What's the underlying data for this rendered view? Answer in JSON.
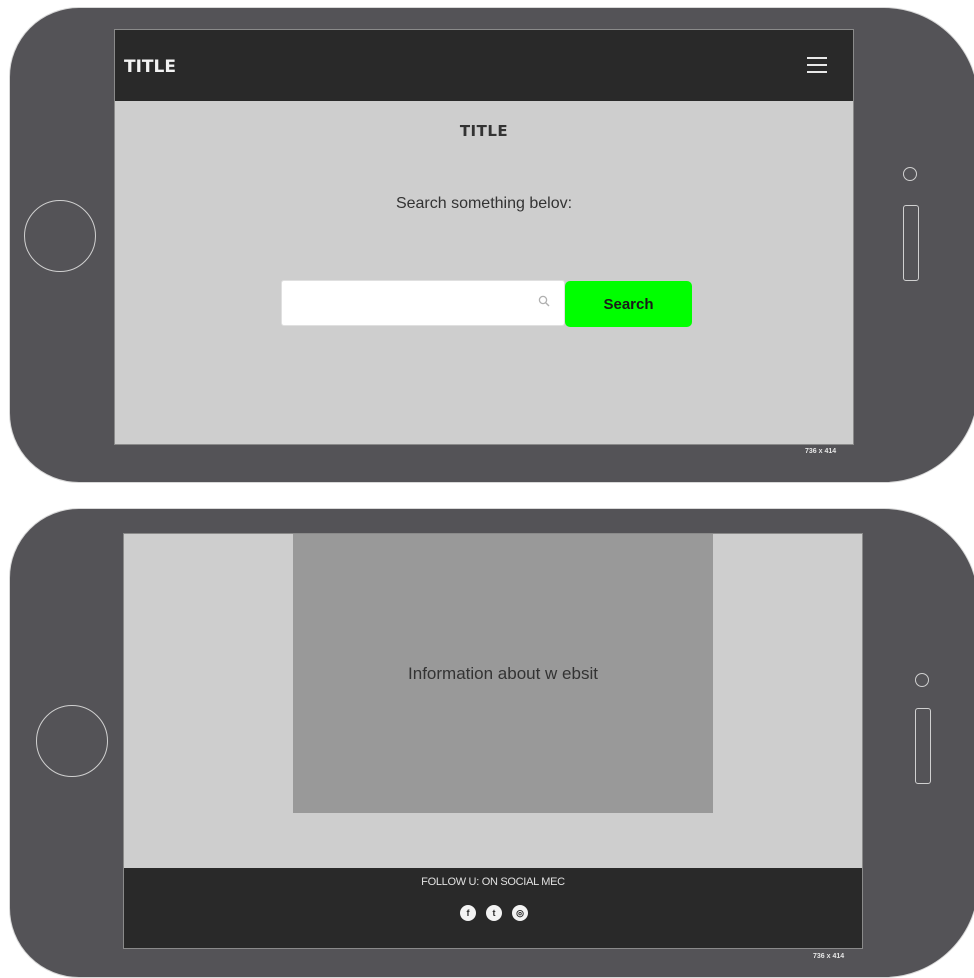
{
  "frame1": {
    "nav_title": "TITLE",
    "menu_icon": "hamburger-menu-icon",
    "page_title": "TITLE",
    "prompt": "Search something belov:",
    "search": {
      "value": "",
      "placeholder": ""
    },
    "search_icon": "magnifier-icon",
    "search_button_label": "Search",
    "search_button_color": "#00ff00",
    "dimensions": "736 x 414"
  },
  "frame2": {
    "info_text": "Information about w ebsit",
    "footer_text": "FOLLOW U: ON SOCIAL MEC",
    "social_icons": [
      "facebook-icon",
      "twitter-icon",
      "instagram-icon"
    ],
    "dimensions": "736 x 414"
  },
  "colors": {
    "device": "#545357",
    "screen": "#cecece",
    "navbar": "#292929",
    "info_block": "#999999"
  }
}
